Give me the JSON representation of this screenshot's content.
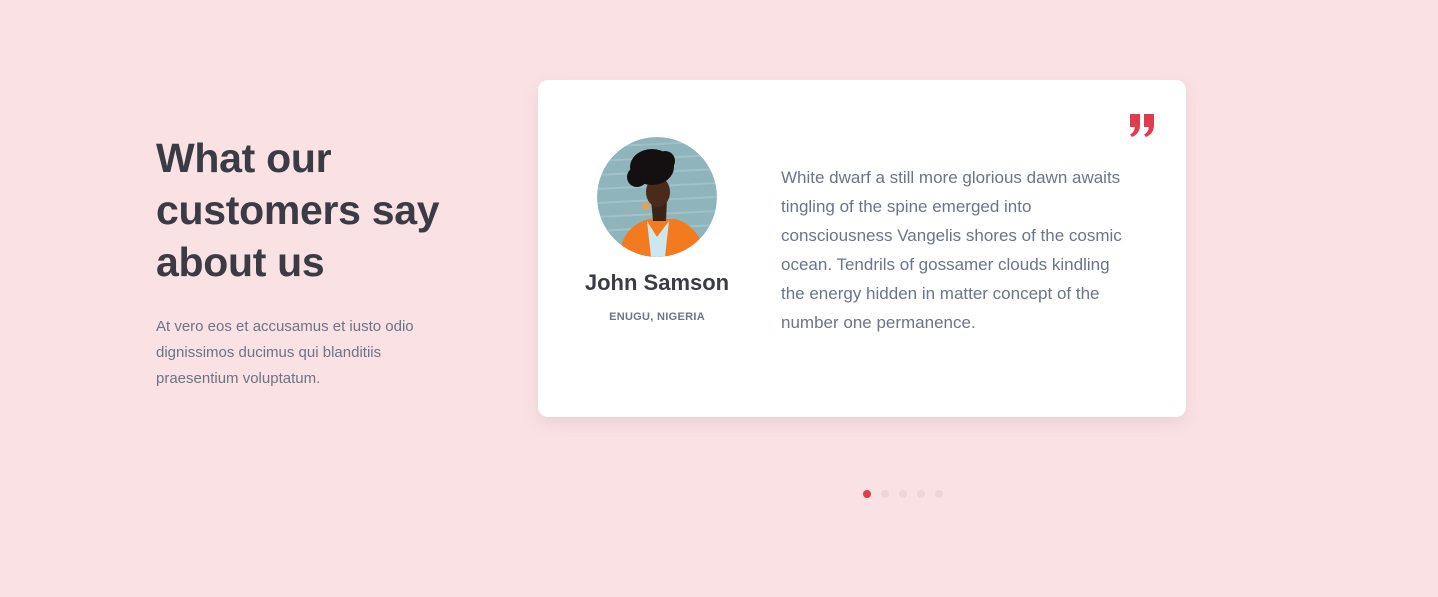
{
  "section": {
    "heading": "What our customers say about us",
    "description": "At vero eos et accusamus et iusto odio dignissimos ducimus qui blanditiis praesentium voluptatum."
  },
  "testimonial": {
    "name": "John Samson",
    "location": "ENUGU, NIGERIA",
    "quote": "White dwarf a still more glorious dawn awaits tingling of the spine emerged into consciousness Vangelis shores of the cosmic ocean. Tendrils of gossamer clouds kindling the energy hidden in matter concept of the number one permanence.",
    "quote_icon": "closing-quote-icon"
  },
  "carousel": {
    "slide_count": 5,
    "active_index": 0
  },
  "colors": {
    "background": "#f9e1e4",
    "accent": "#e13b4e",
    "heading": "#3a3b44",
    "body_text": "#6b7488",
    "card": "#ffffff"
  }
}
